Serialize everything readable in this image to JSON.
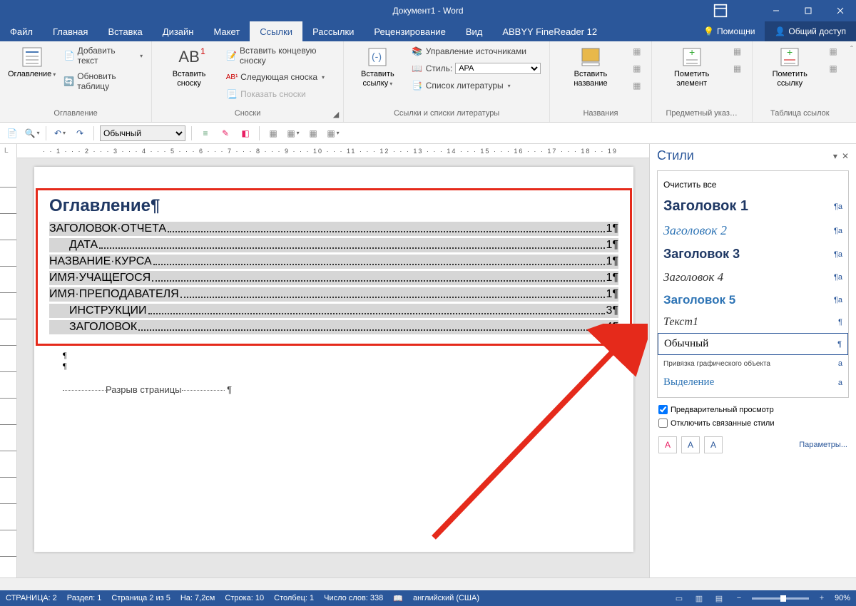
{
  "title": "Документ1 - Word",
  "menu": {
    "file": "Файл",
    "tabs": [
      "Главная",
      "Вставка",
      "Дизайн",
      "Макет",
      "Ссылки",
      "Рассылки",
      "Рецензирование",
      "Вид",
      "ABBYY FineReader 12"
    ],
    "active_index": 4,
    "tell_me": "Помощни",
    "share": "Общий доступ"
  },
  "ribbon": {
    "g1": {
      "label": "Оглавление",
      "big": "Оглавление",
      "add_text": "Добавить текст",
      "update": "Обновить таблицу"
    },
    "g2": {
      "label": "Сноски",
      "big": "Вставить сноску",
      "endnote": "Вставить концевую сноску",
      "next": "Следующая сноска",
      "show": "Показать сноски"
    },
    "g3": {
      "label": "Ссылки и списки литературы",
      "big": "Вставить ссылку",
      "manage": "Управление источниками",
      "style_lbl": "Стиль:",
      "style_val": "APA",
      "biblio": "Список литературы"
    },
    "g4": {
      "label": "Названия",
      "big": "Вставить название"
    },
    "g5": {
      "label": "Предметный указ…",
      "big": "Пометить элемент"
    },
    "g6": {
      "label": "Таблица ссылок",
      "big": "Пометить ссылку"
    }
  },
  "qat": {
    "style": "Обычный"
  },
  "ruler": "· · 1 · · · 2 · · · 3 · · · 4 · · · 5 · · · 6 · · · 7 · · · 8 · · · 9 · · · 10 · · · 11 · · · 12 · · · 13 · · · 14 · · · 15 · · · 16 · · · 17 · · · 18 · · 19",
  "doc": {
    "toc_title": "Оглавление¶",
    "rows": [
      {
        "text": "ЗАГОЛОВОК·ОТЧЕТА",
        "page": "1¶",
        "indent": false
      },
      {
        "text": "ДАТА",
        "page": "1¶",
        "indent": true
      },
      {
        "text": "НАЗВАНИЕ·КУРСА",
        "page": "1¶",
        "indent": false
      },
      {
        "text": "ИМЯ·УЧАЩЕГОСЯ",
        "page": "1¶",
        "indent": false
      },
      {
        "text": "ИМЯ·ПРЕПОДАВАТЕЛЯ",
        "page": "1¶",
        "indent": false
      },
      {
        "text": "ИНСТРУКЦИИ",
        "page": "3¶",
        "indent": true
      },
      {
        "text": "ЗАГОЛОВОК",
        "page": "4¶",
        "indent": true
      }
    ],
    "pagebreak": "Разрыв страницы"
  },
  "styles": {
    "title": "Стили",
    "clear": "Очистить все",
    "items": [
      {
        "name": "Заголовок 1",
        "cls": "h1",
        "mark": "¶a"
      },
      {
        "name": "Заголовок 2",
        "cls": "h2",
        "mark": "¶a"
      },
      {
        "name": "Заголовок 3",
        "cls": "h3",
        "mark": "¶a"
      },
      {
        "name": "Заголовок 4",
        "cls": "h4",
        "mark": "¶a"
      },
      {
        "name": "Заголовок 5",
        "cls": "h5",
        "mark": "¶a"
      },
      {
        "name": "Текст1",
        "cls": "t1",
        "mark": "¶"
      },
      {
        "name": "Обычный",
        "cls": "nrm",
        "mark": "¶"
      },
      {
        "name": "Привязка графического объекта",
        "cls": "anc",
        "mark": "a"
      },
      {
        "name": "Выделение",
        "cls": "hl",
        "mark": "a"
      }
    ],
    "selected_index": 6,
    "preview": "Предварительный просмотр",
    "disable_linked": "Отключить связанные стили",
    "params": "Параметры..."
  },
  "status": {
    "page": "СТРАНИЦА: 2",
    "section": "Раздел: 1",
    "page_of": "Страница 2 из 5",
    "at": "На: 7,2см",
    "line": "Строка: 10",
    "col": "Столбец: 1",
    "words": "Число слов: 338",
    "lang": "английский (США)",
    "zoom": "90%"
  }
}
